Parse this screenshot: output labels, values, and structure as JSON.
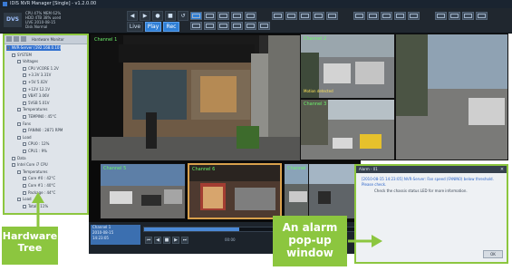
{
  "app": {
    "title": "IDIS NVR Manager [Single] - v1.2.0.00",
    "brand_label": "DVS"
  },
  "status_lines": [
    "CPU 47% MEM 62%",
    "HDD 4TB 38% used",
    "LIVE  2010-08-15",
    "Disk Normal"
  ],
  "toolbar": {
    "buttons_row1": [
      "◀",
      "▶",
      "●",
      "■",
      "↺"
    ],
    "buttons_row2": [
      "Live",
      "Play",
      "Rec"
    ]
  },
  "tree": {
    "header_title": "Hardware Monitor",
    "items": [
      {
        "label": "NVR-Server (192.168.0.10)",
        "selected": true
      },
      {
        "label": "SYSTEM",
        "selected": false
      },
      {
        "label": "Voltages",
        "selected": false
      },
      {
        "label": "CPU VCORE 1.2V",
        "selected": false
      },
      {
        "label": "+3.3V 3.31V",
        "selected": false
      },
      {
        "label": "+5V 5.02V",
        "selected": false
      },
      {
        "label": "+12V 12.1V",
        "selected": false
      },
      {
        "label": "VBAT 3.06V",
        "selected": false
      },
      {
        "label": "5VSB 5.01V",
        "selected": false
      },
      {
        "label": "Temperatures",
        "selected": false
      },
      {
        "label": "TEMPIN0 : 45°C",
        "selected": false
      },
      {
        "label": "Fans",
        "selected": false
      },
      {
        "label": "FANIN0 : 2871 RPM",
        "selected": false
      },
      {
        "label": "Load",
        "selected": false
      },
      {
        "label": "CPU0 : 12%",
        "selected": false
      },
      {
        "label": "CPU1 : 9%",
        "selected": false
      },
      {
        "label": "Data",
        "selected": false
      },
      {
        "label": "Intel Core i7 CPU",
        "selected": false
      },
      {
        "label": "Temperatures",
        "selected": false
      },
      {
        "label": "Core #0 : 42°C",
        "selected": false
      },
      {
        "label": "Core #1 : 40°C",
        "selected": false
      },
      {
        "label": "Package : 44°C",
        "selected": false
      },
      {
        "label": "Load",
        "selected": false
      },
      {
        "label": "Total : 11%",
        "selected": false
      }
    ]
  },
  "cameras": {
    "main": {
      "label": "Channel 1"
    },
    "right_top": {
      "label": "Channel 2",
      "sub": "Motion detected"
    },
    "right_mid": {
      "label": "Channel 3"
    },
    "bottom_1": {
      "label": "Channel 5"
    },
    "bottom_2": {
      "label": "Channel 6"
    },
    "bottom_3": {
      "label": "Channel 7"
    }
  },
  "playback": {
    "info_lines": [
      "Channel 1",
      "2010-08-15",
      "14:23:05"
    ],
    "time_start": "00:00",
    "time_end": "24:00",
    "progress": 0.45,
    "buttons": [
      "⏮",
      "◀",
      "■",
      "▶",
      "⏭"
    ]
  },
  "alarm": {
    "title": "Alarm - 01",
    "message": "[2010-08-15 14:23:05] NVR-Server: Fan speed (FANIN0) below threshold. Please check.",
    "detail": "Check the chassis status LED for more information.",
    "ok_label": "OK",
    "close_glyph": "×"
  },
  "callouts": {
    "hardware_tree": "Hardware Tree",
    "alarm_popup": "An alarm pop-up window"
  },
  "colors": {
    "annotation_green": "#8cc63f",
    "toolbar_bg": "#20272f",
    "accent_blue": "#2f7fd6"
  }
}
